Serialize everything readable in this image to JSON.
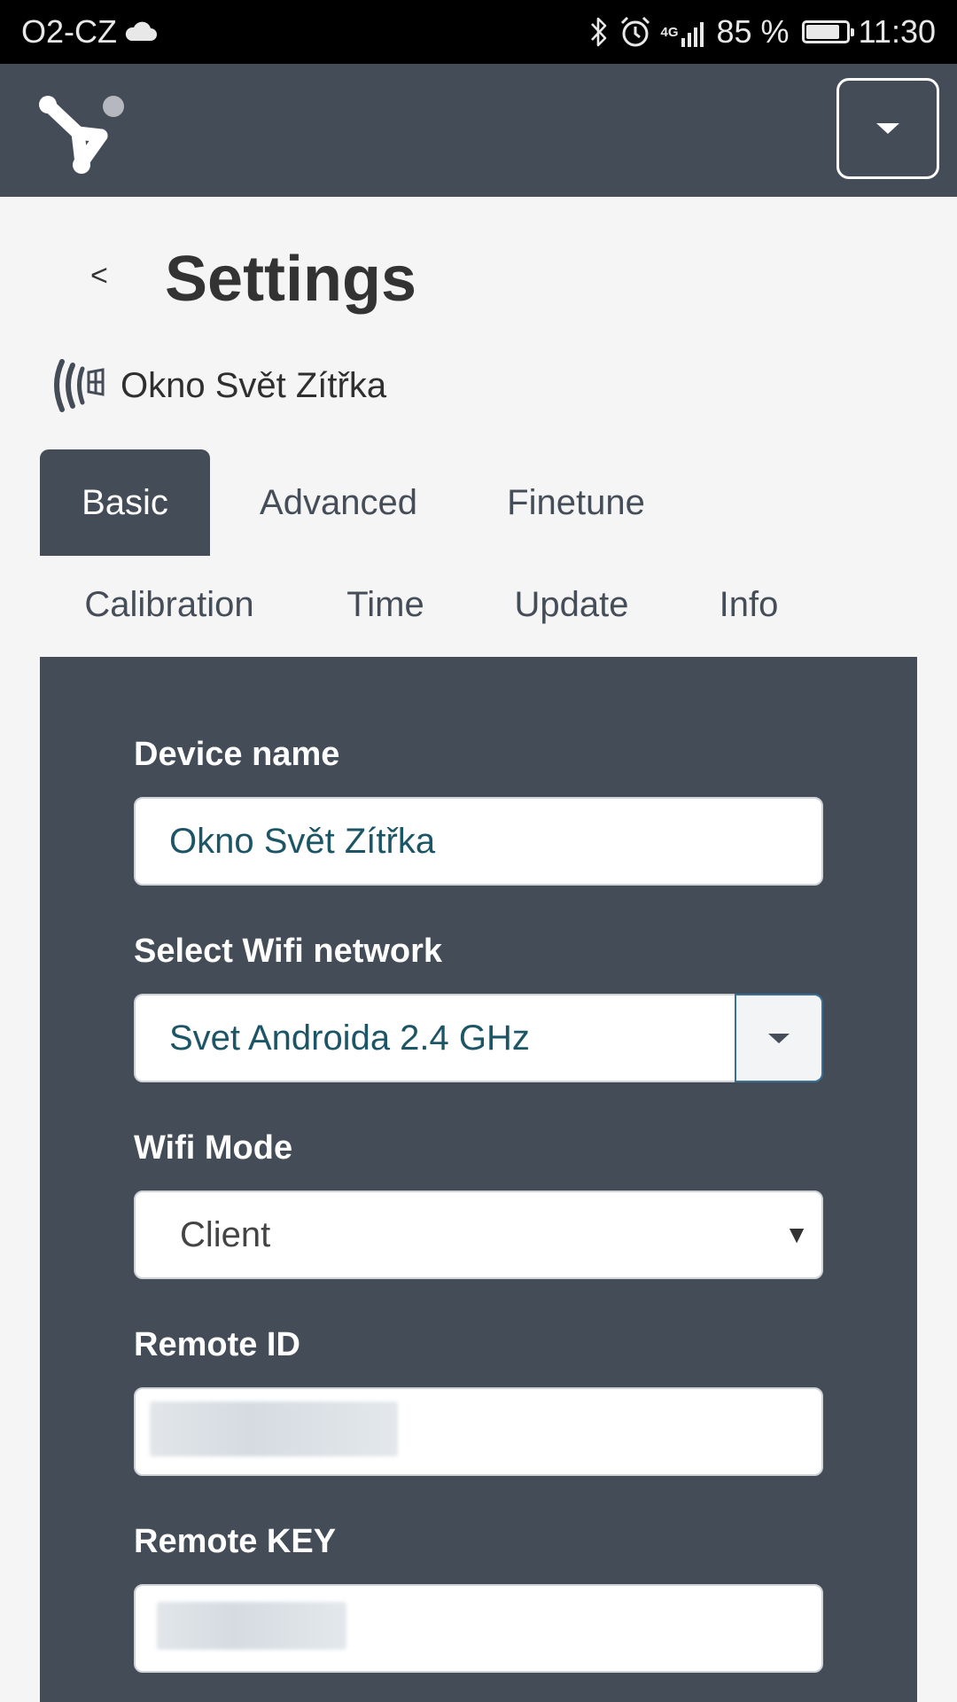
{
  "status_bar": {
    "carrier": "O2-CZ",
    "network": "4G",
    "battery": "85 %",
    "battery_level": 0.85,
    "time": "11:30",
    "icons": [
      "cloud-icon",
      "bluetooth-icon",
      "alarm-icon",
      "signal-icon",
      "battery-icon"
    ]
  },
  "header": {
    "logo": "logo-icon",
    "menu_icon": "chevron-down-icon"
  },
  "page": {
    "back": "<",
    "title": "Settings",
    "device_name": "Okno Svět Zítřka",
    "device_icon": "window-signal-icon"
  },
  "tabs": [
    {
      "label": "Basic",
      "active": true
    },
    {
      "label": "Advanced",
      "active": false
    },
    {
      "label": "Finetune",
      "active": false
    },
    {
      "label": "Calibration",
      "active": false
    },
    {
      "label": "Time",
      "active": false
    },
    {
      "label": "Update",
      "active": false
    },
    {
      "label": "Info",
      "active": false
    }
  ],
  "form": {
    "device_name": {
      "label": "Device name",
      "value": "Okno Svět Zítřka"
    },
    "wifi_network": {
      "label": "Select Wifi network",
      "value": "Svet Androida 2.4 GHz"
    },
    "wifi_mode": {
      "label": "Wifi Mode",
      "value": "Client"
    },
    "remote_id": {
      "label": "Remote ID"
    },
    "remote_key": {
      "label": "Remote KEY"
    }
  },
  "colors": {
    "header_bg": "#444c57",
    "panel_bg": "#444c57",
    "page_bg": "#f5f5f5",
    "input_text": "#1c5566"
  }
}
